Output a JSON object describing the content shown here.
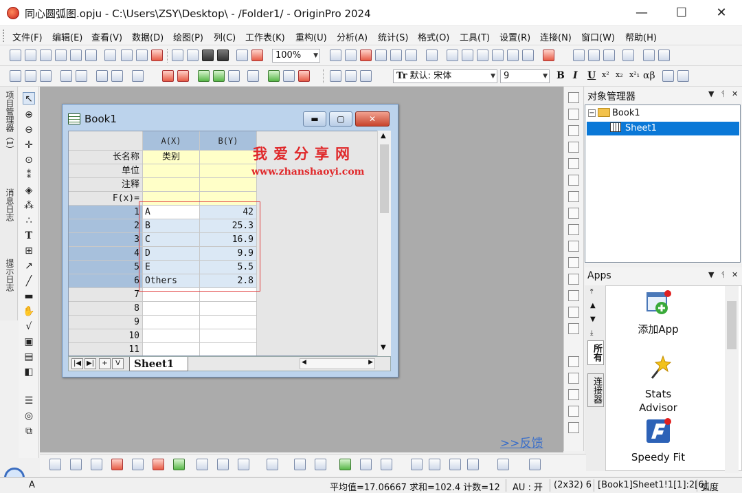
{
  "window": {
    "title": "同心圆弧图.opju - C:\\Users\\ZSY\\Desktop\\ - /Folder1/ - OriginPro 2024",
    "minimize": "—",
    "maximize": "☐",
    "close": "✕"
  },
  "menu": [
    "文件(F)",
    "编辑(E)",
    "查看(V)",
    "数据(D)",
    "绘图(P)",
    "列(C)",
    "工作表(K)",
    "重构(U)",
    "分析(A)",
    "统计(S)",
    "格式(O)",
    "工具(T)",
    "设置(R)",
    "连接(N)",
    "窗口(W)",
    "帮助(H)"
  ],
  "toolbar": {
    "zoom_value": "100%",
    "font_name": "默认: 宋体",
    "font_size": "9",
    "bold": "B",
    "italic": "I",
    "underline": "U",
    "greek": "αβ",
    "font_prefix": "Tr"
  },
  "left_tabs": [
    "项目管理器（1）",
    "消息日志",
    "提示日志"
  ],
  "book": {
    "title": "Book1",
    "columns": [
      "A(X)",
      "B(Y)"
    ],
    "meta_rows": [
      {
        "label": "长名称",
        "a": "类别",
        "b": ""
      },
      {
        "label": "单位",
        "a": "",
        "b": ""
      },
      {
        "label": "注释",
        "a": "",
        "b": ""
      },
      {
        "label": "F(x)=",
        "a": "",
        "b": ""
      }
    ],
    "rows": [
      {
        "n": "1",
        "a": "A",
        "b": "42"
      },
      {
        "n": "2",
        "a": "B",
        "b": "25.3"
      },
      {
        "n": "3",
        "a": "C",
        "b": "16.9"
      },
      {
        "n": "4",
        "a": "D",
        "b": "9.9"
      },
      {
        "n": "5",
        "a": "E",
        "b": "5.5"
      },
      {
        "n": "6",
        "a": "Others",
        "b": "2.8"
      },
      {
        "n": "7",
        "a": "",
        "b": ""
      },
      {
        "n": "8",
        "a": "",
        "b": ""
      },
      {
        "n": "9",
        "a": "",
        "b": ""
      },
      {
        "n": "10",
        "a": "",
        "b": ""
      },
      {
        "n": "11",
        "a": "",
        "b": ""
      }
    ],
    "sheet_tab": "Sheet1",
    "nav_buttons": [
      "|◀",
      "▶|",
      "+",
      "V"
    ]
  },
  "watermark": {
    "cn": "我爱分享网",
    "url": "www.zhanshaoyi.com"
  },
  "feedback": ">>反馈",
  "object_manager": {
    "title": "对象管理器",
    "book": "Book1",
    "sheet": "Sheet1"
  },
  "apps": {
    "title": "Apps",
    "tab_all": "所有",
    "tab_connect": "连接器",
    "items": [
      "添加App",
      "Stats Advisor",
      "Speedy Fit"
    ]
  },
  "status": {
    "cell": "A",
    "summary": "平均值=17.06667 求和=102.4 计数=12",
    "au": "AU : 开",
    "dims": "(2x32) 6",
    "range": "[Book1]Sheet1!1[1]:2[6]",
    "angle": "弧度"
  },
  "colors": {
    "selection_blue": "#0a78d7",
    "header_blue": "#a7c0dc",
    "meta_yellow": "#ffffc8",
    "data_blue": "#dbe8f5",
    "watermark_red": "#e0282a"
  }
}
